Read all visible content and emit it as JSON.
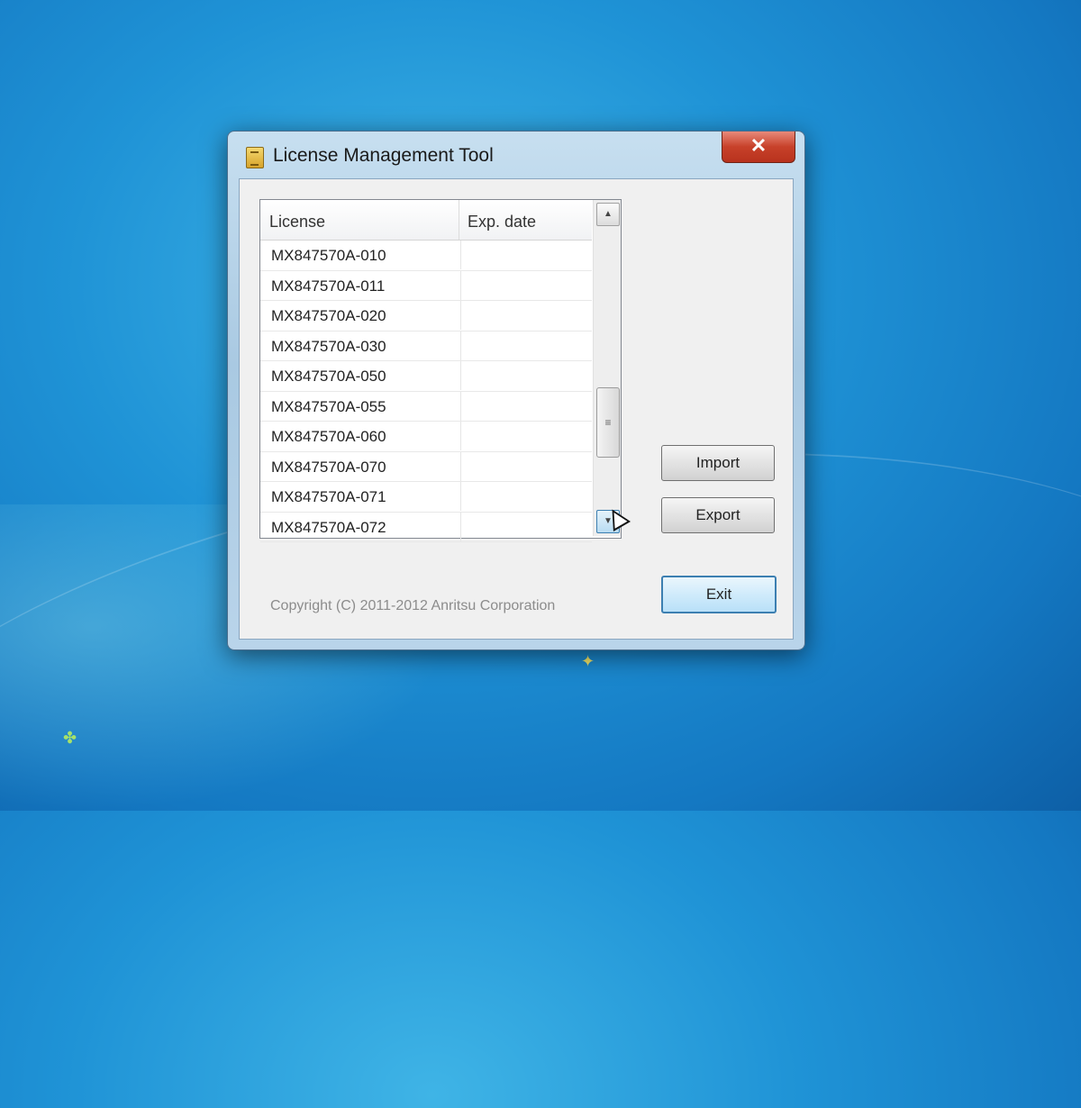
{
  "window": {
    "title": "License Management Tool",
    "close_label": "✕"
  },
  "listview": {
    "columns": [
      "License",
      "Exp. date"
    ],
    "rows": [
      {
        "license": "MX847570A-010",
        "exp_date": ""
      },
      {
        "license": "MX847570A-011",
        "exp_date": ""
      },
      {
        "license": "MX847570A-020",
        "exp_date": ""
      },
      {
        "license": "MX847570A-030",
        "exp_date": ""
      },
      {
        "license": "MX847570A-050",
        "exp_date": ""
      },
      {
        "license": "MX847570A-055",
        "exp_date": ""
      },
      {
        "license": "MX847570A-060",
        "exp_date": ""
      },
      {
        "license": "MX847570A-070",
        "exp_date": ""
      },
      {
        "license": "MX847570A-071",
        "exp_date": ""
      },
      {
        "license": "MX847570A-072",
        "exp_date": ""
      }
    ],
    "scroll_up_glyph": "▲",
    "scroll_down_glyph": "▼",
    "thumb_glyph": "≡"
  },
  "buttons": {
    "import_label": "Import",
    "export_label": "Export",
    "exit_label": "Exit"
  },
  "footer": {
    "copyright": "Copyright (C) 2011-2012 Anritsu Corporation"
  },
  "colors": {
    "desktop_blue": "#1f93d6",
    "close_red": "#c7412a",
    "default_button_border": "#3c7fb1"
  }
}
